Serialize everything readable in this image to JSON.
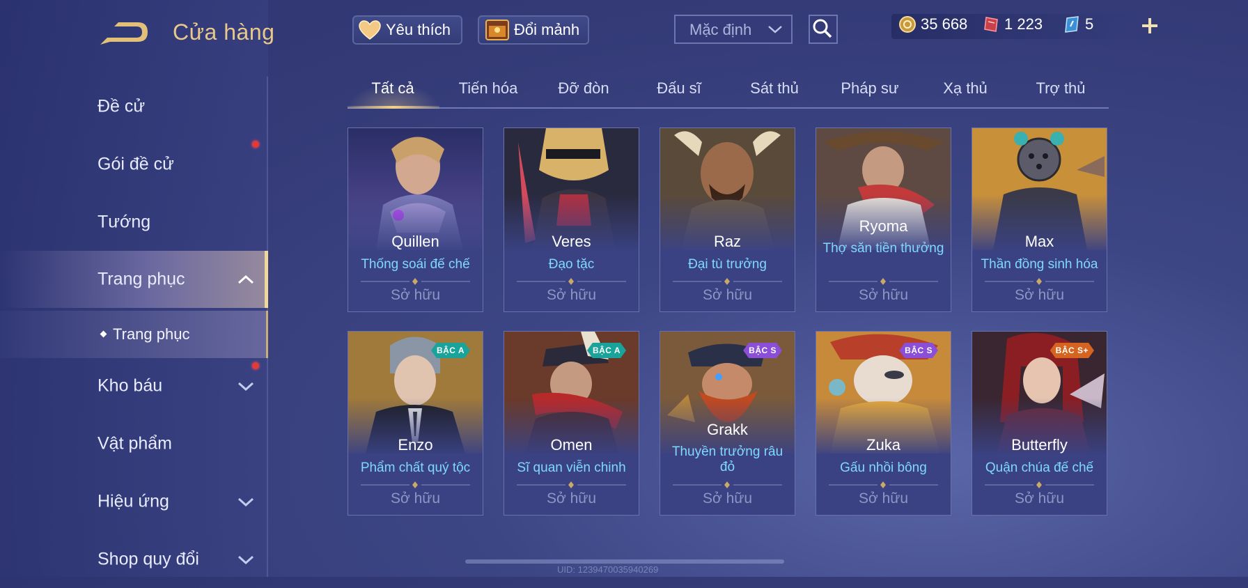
{
  "header": {
    "title": "Cửa hàng"
  },
  "sidebar": {
    "items": [
      {
        "label": "Đề cử"
      },
      {
        "label": "Gói đề cử"
      },
      {
        "label": "Tướng"
      },
      {
        "label": "Trang phục"
      },
      {
        "label": "Kho báu"
      },
      {
        "label": "Vật phẩm"
      },
      {
        "label": "Hiệu ứng"
      },
      {
        "label": "Shop quy đổi"
      }
    ],
    "sub_item": {
      "label": "Trang phục"
    }
  },
  "toolbar": {
    "favorites_label": "Yêu thích",
    "exchange_label": "Đổi mảnh",
    "sort_value": "Mặc định"
  },
  "currencies": [
    {
      "value": "35 668"
    },
    {
      "value": "1 223"
    },
    {
      "value": "5"
    }
  ],
  "tabs": [
    {
      "label": "Tất cả"
    },
    {
      "label": "Tiến hóa"
    },
    {
      "label": "Đỡ đòn"
    },
    {
      "label": "Đấu sĩ"
    },
    {
      "label": "Sát thủ"
    },
    {
      "label": "Pháp sư"
    },
    {
      "label": "Xạ thủ"
    },
    {
      "label": "Trợ thủ"
    }
  ],
  "skins": [
    {
      "hero": "Quillen",
      "skin": "Thống soái đế chế",
      "status": "Sở hữu",
      "badge": ""
    },
    {
      "hero": "Veres",
      "skin": "Đạo tặc",
      "status": "Sở hữu",
      "badge": ""
    },
    {
      "hero": "Raz",
      "skin": "Đại tù trưởng",
      "status": "Sở hữu",
      "badge": ""
    },
    {
      "hero": "Ryoma",
      "skin": "Thợ săn tiền thưởng",
      "status": "Sở hữu",
      "badge": ""
    },
    {
      "hero": "Max",
      "skin": "Thần đồng sinh hóa",
      "status": "Sở hữu",
      "badge": ""
    },
    {
      "hero": "Enzo",
      "skin": "Phẩm chất quý tộc",
      "status": "Sở hữu",
      "badge": "BẬC A"
    },
    {
      "hero": "Omen",
      "skin": "Sĩ quan viễn chinh",
      "status": "Sở hữu",
      "badge": "BẬC A"
    },
    {
      "hero": "Grakk",
      "skin": "Thuyền trưởng râu đỏ",
      "status": "Sở hữu",
      "badge": "BẬC S"
    },
    {
      "hero": "Zuka",
      "skin": "Gấu nhồi bông",
      "status": "Sở hữu",
      "badge": "BẬC S"
    },
    {
      "hero": "Butterfly",
      "skin": "Quận chúa đế chế",
      "status": "Sở hữu",
      "badge": "BẬC S+"
    }
  ],
  "footer": {
    "uid": "UID: 1239470035940269"
  },
  "colors": {
    "accent_gold": "#e9c98a",
    "skin_name_blue": "#7fd8ff",
    "badge_a": "#1aa39a",
    "badge_s": "#8a4fd6",
    "badge_s_plus": "#d4641f",
    "notification_red": "#e23a3a"
  }
}
